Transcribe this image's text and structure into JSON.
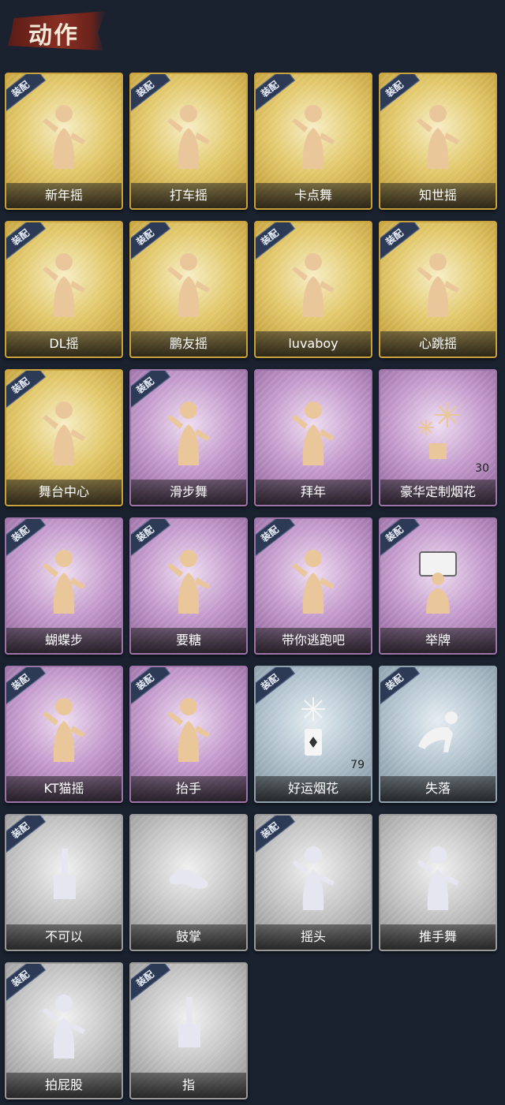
{
  "header": {
    "title": "动作"
  },
  "tag_text": "装配",
  "cards": [
    {
      "label": "新年摇",
      "style": "gold",
      "tag": true,
      "count": "",
      "icon": "dance-figure-icon"
    },
    {
      "label": "打车摇",
      "style": "gold",
      "tag": true,
      "count": "",
      "icon": "dance-figure-icon"
    },
    {
      "label": "卡点舞",
      "style": "gold",
      "tag": true,
      "count": "",
      "icon": "dance-figure-icon"
    },
    {
      "label": "知世摇",
      "style": "gold",
      "tag": true,
      "count": "",
      "icon": "dance-figure-icon"
    },
    {
      "label": "DL摇",
      "style": "gold",
      "tag": true,
      "count": "",
      "icon": "dance-figure-icon"
    },
    {
      "label": "鹏友摇",
      "style": "gold",
      "tag": true,
      "count": "",
      "icon": "dance-figure-icon"
    },
    {
      "label": "luvaboy",
      "style": "gold",
      "tag": true,
      "count": "",
      "icon": "dance-figure-icon"
    },
    {
      "label": "心跳摇",
      "style": "gold",
      "tag": true,
      "count": "",
      "icon": "dance-figure-icon"
    },
    {
      "label": "舞台中心",
      "style": "gold",
      "tag": true,
      "count": "",
      "icon": "dance-figure-icon"
    },
    {
      "label": "滑步舞",
      "style": "purple",
      "tag": true,
      "count": "",
      "icon": "dance-figure-icon"
    },
    {
      "label": "拜年",
      "style": "purple",
      "tag": false,
      "count": "",
      "icon": "bow-figure-icon"
    },
    {
      "label": "豪华定制烟花",
      "style": "purple",
      "tag": false,
      "count": "30",
      "icon": "fireworks-icon"
    },
    {
      "label": "蝴蝶步",
      "style": "purple",
      "tag": true,
      "count": "",
      "icon": "dance-figure-icon"
    },
    {
      "label": "要糖",
      "style": "purple",
      "tag": true,
      "count": "",
      "icon": "figure-icon"
    },
    {
      "label": "带你逃跑吧",
      "style": "purple",
      "tag": true,
      "count": "",
      "icon": "dance-figure-icon"
    },
    {
      "label": "举牌",
      "style": "purple",
      "tag": true,
      "count": "",
      "icon": "sign-figure-icon"
    },
    {
      "label": "KT猫摇",
      "style": "purple",
      "tag": true,
      "count": "",
      "icon": "dance-figure-icon"
    },
    {
      "label": "抬手",
      "style": "purple",
      "tag": true,
      "count": "",
      "icon": "figure-icon"
    },
    {
      "label": "好运烟花",
      "style": "blue",
      "tag": true,
      "count": "79",
      "icon": "firework-can-icon"
    },
    {
      "label": "失落",
      "style": "blue",
      "tag": true,
      "count": "",
      "icon": "crawl-figure-icon"
    },
    {
      "label": "不可以",
      "style": "gray",
      "tag": true,
      "count": "",
      "icon": "finger-icon"
    },
    {
      "label": "鼓掌",
      "style": "gray",
      "tag": false,
      "count": "",
      "icon": "clap-icon"
    },
    {
      "label": "摇头",
      "style": "gray",
      "tag": true,
      "count": "",
      "icon": "figure-icon"
    },
    {
      "label": "推手舞",
      "style": "gray",
      "tag": false,
      "count": "",
      "icon": "figure-icon"
    },
    {
      "label": "拍屁股",
      "style": "gray",
      "tag": true,
      "count": "",
      "icon": "figure-icon"
    },
    {
      "label": "指",
      "style": "gray",
      "tag": true,
      "count": "",
      "icon": "point-hand-icon"
    }
  ]
}
